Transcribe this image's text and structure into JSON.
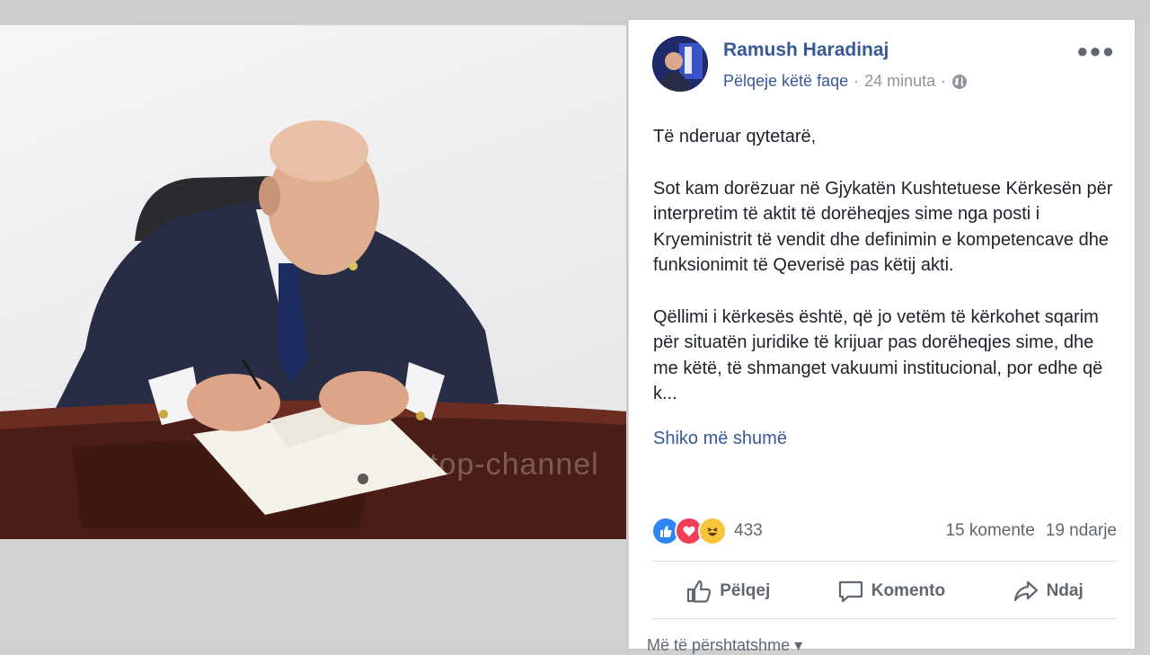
{
  "post": {
    "author": "Ramush Haradinaj",
    "like_page": "Pëlqeje këtë faqe",
    "separator": "·",
    "time": "24 minuta",
    "privacy_icon": "globe-icon",
    "more_icon": "more-options-icon",
    "greeting": "Të nderuar qytetarë,",
    "paragraph1": "Sot kam dorëzuar në Gjykatën Kushtetuese Kërkesën për interpretim të aktit të dorëheqjes sime nga posti i Kryeministrit të vendit dhe definimin e kompetencave dhe funksionimit të Qeverisë pas këtij akti.",
    "paragraph2": "Qëllimi i kërkesës është, që jo vetëm të kërkohet sqarim për situatën juridike të krijuar pas dorëheqjes sime, dhe me këtë, të shmanget vakuumi institucional, por edhe që k...",
    "see_more": "Shiko më shumë"
  },
  "reactions": {
    "icons": [
      "like-reaction-icon",
      "love-reaction-icon",
      "haha-reaction-icon"
    ],
    "count": "433",
    "comments": "15 komente",
    "shares": "19 ndarje"
  },
  "actions": {
    "like": "Pëlqej",
    "comment": "Komento",
    "share": "Ndaj"
  },
  "footer": {
    "relevant": "Më të përshtatshme"
  },
  "photo": {
    "watermark": "top-channel"
  },
  "colors": {
    "link": "#385898",
    "text": "#1d2129",
    "muted": "#606770",
    "like": "#2f86f6",
    "love": "#f33e58",
    "haha": "#f7c53a"
  }
}
